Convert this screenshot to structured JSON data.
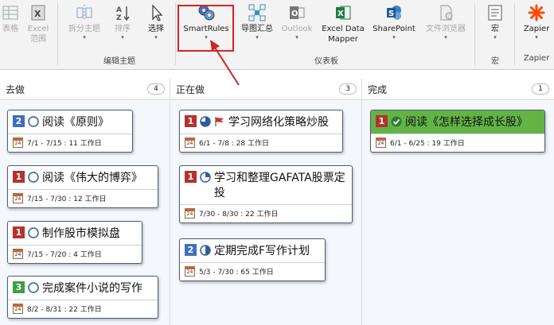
{
  "ribbon": {
    "buttons": [
      {
        "id": "table",
        "label": "表格",
        "disabled": true,
        "icon": "table-icon"
      },
      {
        "id": "excel-range",
        "label": "Excel\n范围",
        "disabled": true,
        "icon": "excel-range-icon"
      },
      {
        "id": "split-topic",
        "label": "拆分主题",
        "disabled": true,
        "icon": "split-topic-icon"
      },
      {
        "id": "sort",
        "label": "排序",
        "disabled": true,
        "icon": "sort-az-icon"
      },
      {
        "id": "select",
        "label": "选择",
        "disabled": false,
        "icon": "cursor-icon"
      },
      {
        "id": "smartrules",
        "label": "SmartRules",
        "disabled": false,
        "icon": "smartrules-gear-icon"
      },
      {
        "id": "map-summary",
        "label": "导图汇总",
        "disabled": false,
        "icon": "map-summary-icon"
      },
      {
        "id": "outlook",
        "label": "Outlook",
        "disabled": true,
        "icon": "outlook-icon"
      },
      {
        "id": "excel-data-mapper",
        "label": "Excel Data\nMapper",
        "disabled": false,
        "icon": "excel-icon"
      },
      {
        "id": "sharepoint",
        "label": "SharePoint",
        "disabled": false,
        "icon": "sharepoint-icon"
      },
      {
        "id": "file-browser",
        "label": "文件浏览器",
        "disabled": true,
        "icon": "file-browser-icon"
      },
      {
        "id": "macro",
        "label": "宏",
        "disabled": false,
        "icon": "macro-icon"
      },
      {
        "id": "zapier",
        "label": "Zapier",
        "disabled": false,
        "icon": "zapier-icon"
      }
    ],
    "groups": {
      "edit_topic": "编辑主题",
      "dashboard": "仪表板",
      "macro": "宏",
      "zapier": "Zapier"
    },
    "accent_color": "#d22222"
  },
  "board": {
    "columns": [
      {
        "title": "去做",
        "count": "4",
        "cards": [
          {
            "priority": "2",
            "status": "not-started",
            "title": "阅读《原则》",
            "dates": "7/1 - 7/15 : 11 工作日"
          },
          {
            "priority": "1",
            "status": "not-started",
            "title": "阅读《伟大的博弈》",
            "dates": "7/15 - 7/30 : 12 工作日"
          },
          {
            "priority": "1",
            "status": "not-started",
            "title": "制作股市模拟盘",
            "dates": "7/15 - 7/20 : 4 工作日"
          },
          {
            "priority": "3",
            "status": "not-started",
            "title": "完成案件小说的写作",
            "dates": "8/2 - 8/31 : 22 工作日"
          }
        ]
      },
      {
        "title": "正在做",
        "count": "3",
        "cards": [
          {
            "priority": "1",
            "status": "three-quarter",
            "flag": true,
            "title": "学习网络化策略炒股",
            "dates": "6/1 - 7/8 : 28 工作日"
          },
          {
            "priority": "1",
            "status": "quarter",
            "title": "学习和整理GAFATA股票定投",
            "dates": "7/30 - 8/30 : 22 工作日"
          },
          {
            "priority": "2",
            "status": "half",
            "title": "定期完成F写作计划",
            "dates": "5/3 - 7/30 : 65 工作日"
          }
        ]
      },
      {
        "title": "完成",
        "count": "1",
        "cards": [
          {
            "priority": "1",
            "status": "complete",
            "title": "阅读《怎样选择成长股》",
            "dates": "6/1 - 6/25 : 19 工作日"
          }
        ]
      }
    ],
    "calendar_icon_text": "24"
  }
}
